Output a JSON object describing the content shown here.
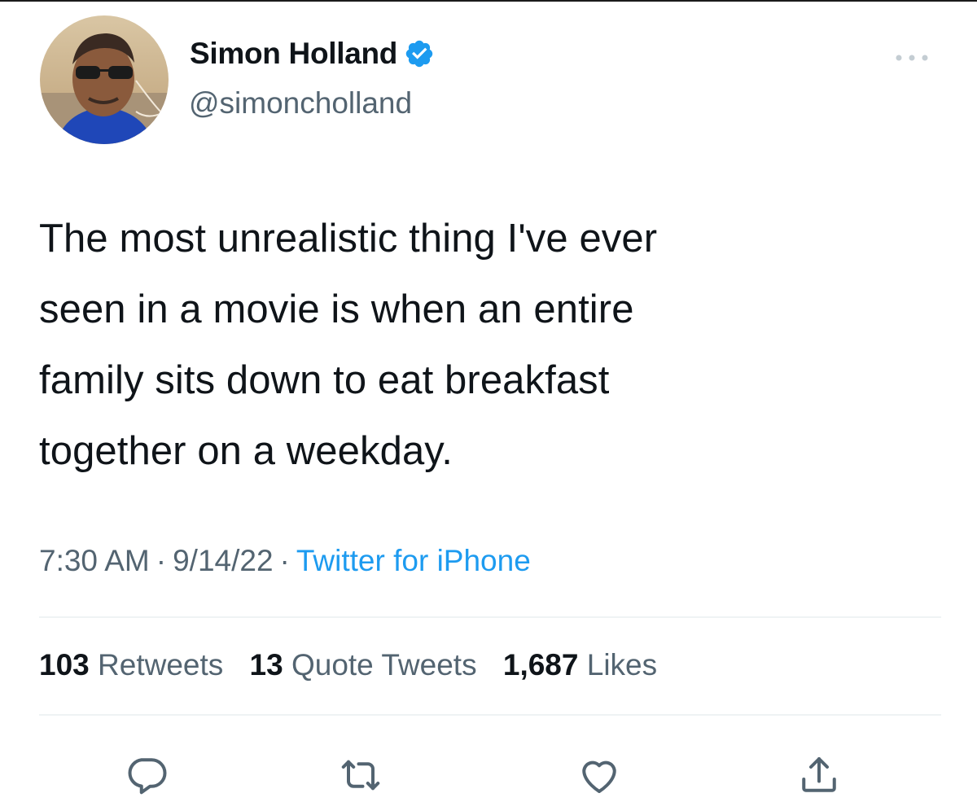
{
  "author": {
    "display_name": "Simon Holland",
    "handle": "@simoncholland",
    "verified": true
  },
  "icons": {
    "avatar": "user-avatar",
    "verified": "verified-badge-icon",
    "more": "more-options-icon",
    "reply": "reply-icon",
    "retweet": "retweet-icon",
    "like": "like-icon",
    "share": "share-icon"
  },
  "colors": {
    "accent": "#1d9bf0",
    "text_primary": "#0f1419",
    "text_secondary": "#536471"
  },
  "tweet": {
    "lines": [
      "The most unrealistic thing I've ever",
      "seen in a movie is when an entire",
      "family sits down to eat breakfast",
      "together on a weekday."
    ],
    "time": "7:30 AM",
    "date": "9/14/22",
    "source": "Twitter for iPhone",
    "separator": "·"
  },
  "stats": {
    "retweets": {
      "count": "103",
      "label": "Retweets"
    },
    "quotes": {
      "count": "13",
      "label": "Quote Tweets"
    },
    "likes": {
      "count": "1,687",
      "label": "Likes"
    }
  }
}
